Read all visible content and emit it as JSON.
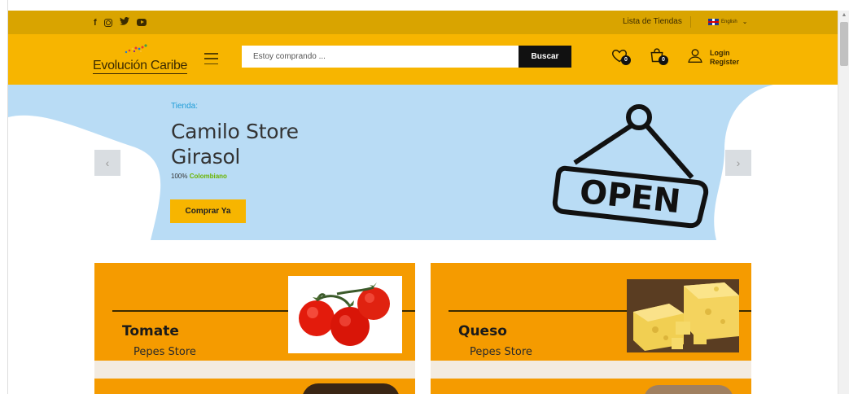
{
  "topbar": {
    "social": [
      "facebook-icon",
      "instagram-icon",
      "twitter-icon",
      "youtube-icon"
    ],
    "store_list_label": "Lista de Tiendas",
    "language_label": "English"
  },
  "header": {
    "logo_text": "Evolución Caribe",
    "search_placeholder": "Estoy comprando ...",
    "search_button": "Buscar",
    "wishlist_count": "0",
    "cart_count": "0",
    "login_label": "Login",
    "register_label": "Register"
  },
  "hero": {
    "label": "Tienda:",
    "title_line1": "Camilo Store",
    "title_line2": "Girasol",
    "subtitle_prefix": "100%",
    "subtitle_highlight": "Colombiano",
    "cta": "Comprar Ya",
    "sign_text": "OPEN",
    "prev_arrow": "‹",
    "next_arrow": "›"
  },
  "products": [
    {
      "name": "Tomate",
      "store": "Pepes Store"
    },
    {
      "name": "Queso",
      "store": "Pepes Store"
    }
  ],
  "colors": {
    "topbar": "#d9a400",
    "header": "#f7b500",
    "hero_bg": "#b9dcf5",
    "card_bg": "#f59b00",
    "accent_blue": "#1e9cd7",
    "accent_green": "#6bb400"
  }
}
